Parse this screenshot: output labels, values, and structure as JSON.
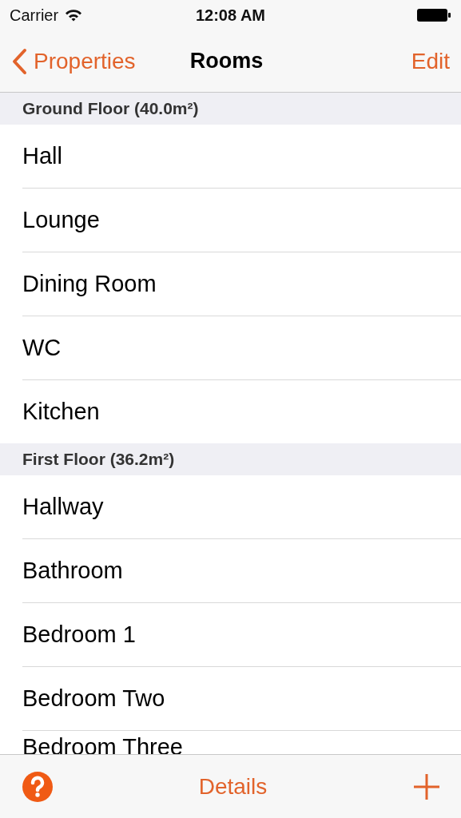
{
  "status_bar": {
    "carrier": "Carrier",
    "time": "12:08 AM"
  },
  "nav_bar": {
    "back": "Properties",
    "title": "Rooms",
    "action": "Edit"
  },
  "sections": [
    {
      "title": "Ground Floor (40.0m²)",
      "rows": [
        "Hall",
        "Lounge",
        "Dining Room",
        "WC",
        "Kitchen"
      ]
    },
    {
      "title": "First Floor (36.2m²)",
      "rows": [
        "Hallway",
        "Bathroom",
        "Bedroom 1",
        "Bedroom Two",
        "Bedroom Three"
      ]
    }
  ],
  "toolbar": {
    "center": "Details"
  }
}
